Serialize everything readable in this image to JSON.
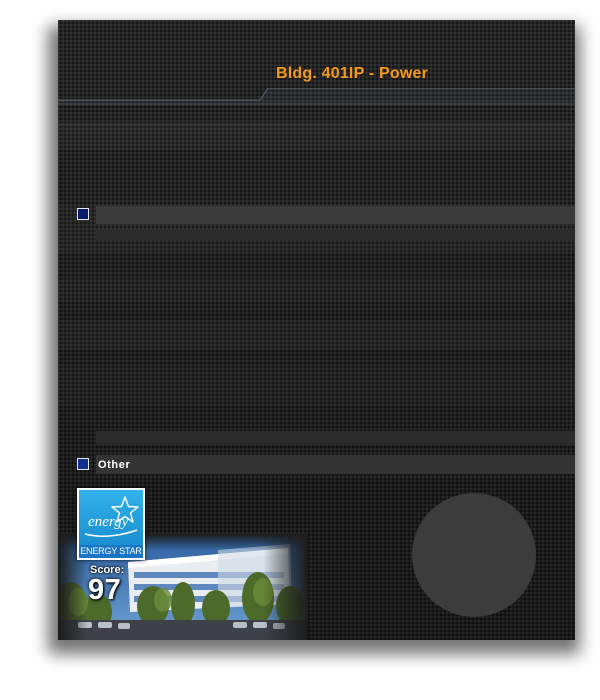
{
  "header": {
    "title": "Bldg. 401IP -  Power"
  },
  "legend": {
    "items": [
      {
        "label": "",
        "color": "#0c1a6b"
      },
      {
        "label": "Other",
        "color": "#12318f"
      }
    ]
  },
  "energy_star": {
    "logo_script": "energy",
    "logo_text": "ENERGY STAR",
    "score_label": "Score:",
    "score_value": "97"
  },
  "gauge": {
    "color": "#3c3c3c"
  },
  "colors": {
    "title": "#f39a1e",
    "panel_background": "#1c1c1c"
  }
}
